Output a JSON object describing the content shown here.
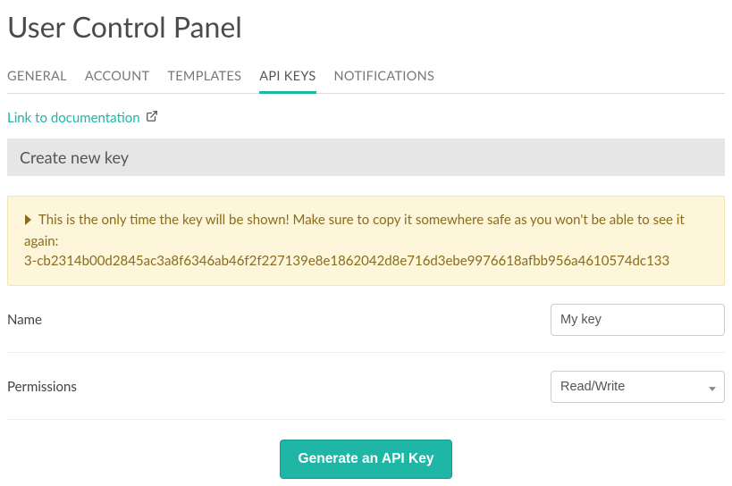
{
  "title": "User Control Panel",
  "tabs": {
    "general": "GENERAL",
    "account": "ACCOUNT",
    "templates": "TEMPLATES",
    "api_keys": "API KEYS",
    "notifications": "NOTIFICATIONS"
  },
  "doc_link_label": "Link to documentation",
  "section_header": "Create new key",
  "alert": {
    "line1": "This is the only time the key will be shown! Make sure to copy it somewhere safe as you won't be able to see it again:",
    "key": "3-cb2314b00d2845ac3a8f6346ab46f2f227139e8e1862042d8e716d3ebe9976618afbb956a4610574dc133"
  },
  "form": {
    "name_label": "Name",
    "name_value": "My key",
    "permissions_label": "Permissions",
    "permissions_value": "Read/Write"
  },
  "submit_label": "Generate an API Key"
}
